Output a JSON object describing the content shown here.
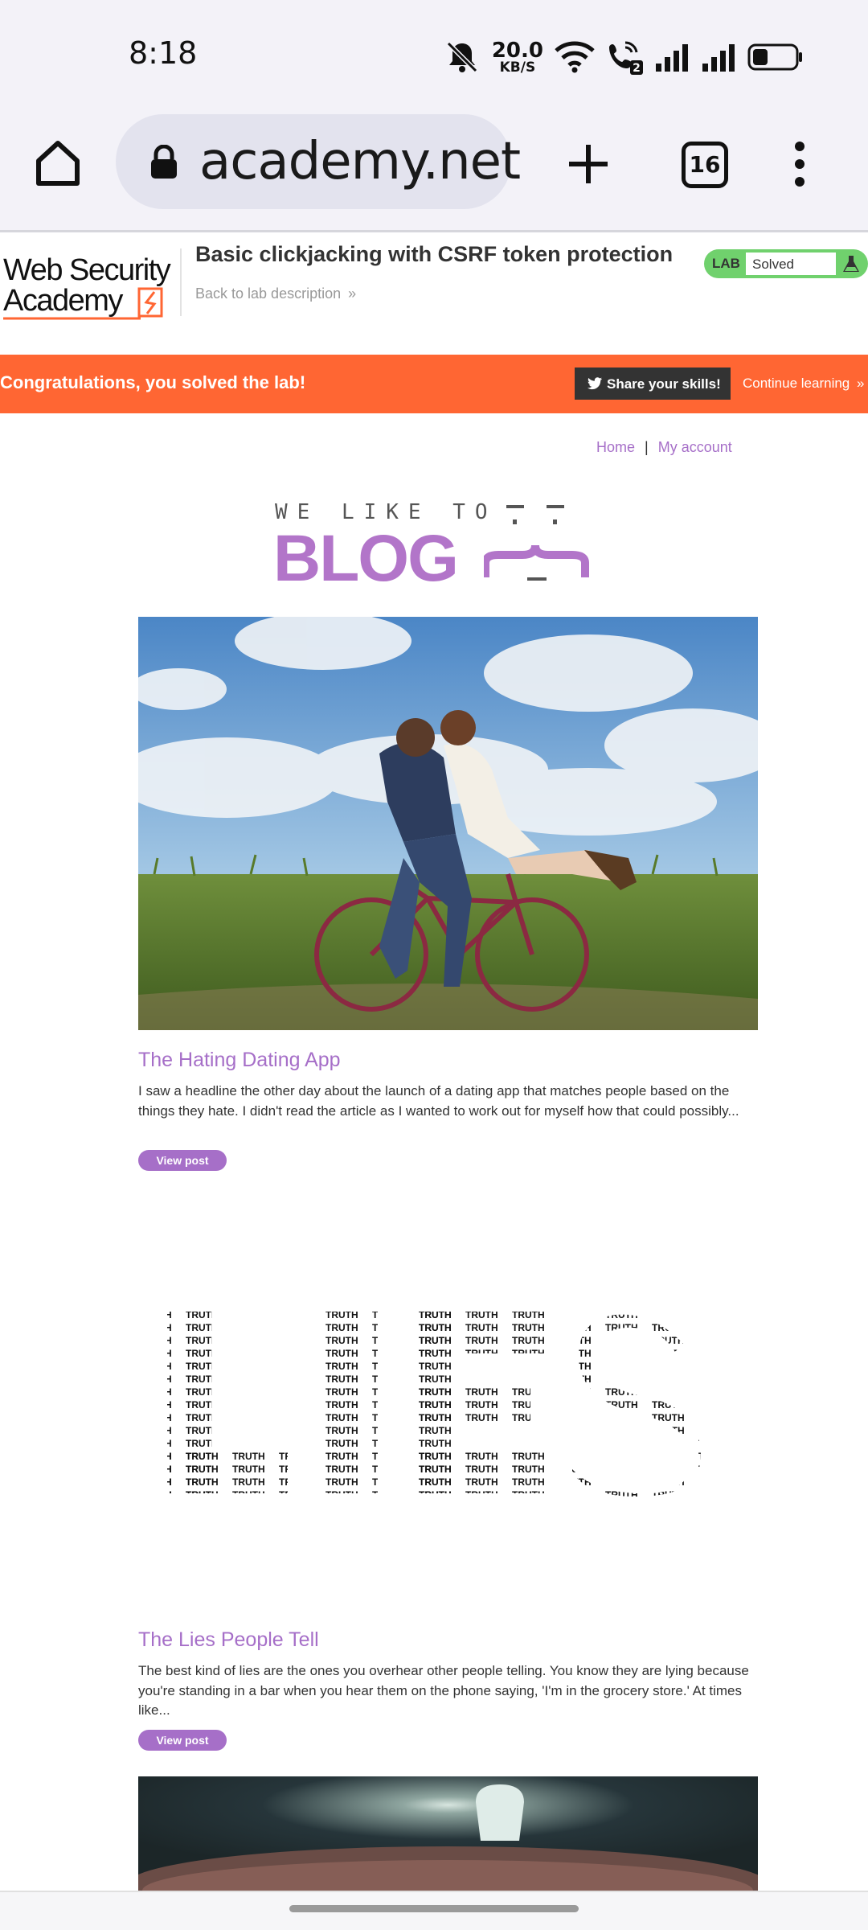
{
  "status_bar": {
    "time": "8:18",
    "net_speed_value": "20.0",
    "net_speed_unit": "KB/S",
    "sim_badge": "2"
  },
  "browser": {
    "url": "academy.net",
    "tab_count": "16"
  },
  "lab_header": {
    "logo_line1": "Web Security",
    "logo_line2": "Academy",
    "title": "Basic clickjacking with CSRF token protection",
    "back_link": "Back to lab description",
    "back_chevrons": "»",
    "badge_lab": "LAB",
    "badge_status": "Solved",
    "status_color": "#70d16d"
  },
  "banner": {
    "message": "Congratulations, you solved the lab!",
    "share_label": "Share your skills!",
    "continue_label": "Continue learning",
    "continue_chevrons": "»",
    "color": "#ff6633"
  },
  "blog_nav": {
    "home": "Home",
    "separator": "|",
    "account": "My account"
  },
  "blog_logo": {
    "tagline": "WE LIKE TO",
    "word": "BLOG",
    "accent": "#b275c9"
  },
  "posts": [
    {
      "title": "The Hating Dating App",
      "summary": "I saw a headline the other day about the launch of a dating app that matches people based on the things they hate. I didn't read the article as I wanted to work out for myself how that could possibly...",
      "button": "View post"
    },
    {
      "title": "The Lies People Tell",
      "summary": "The best kind of lies are the ones you overhear other people telling. You know they are lying because you're standing in a bar when you hear them on the phone saying, 'I'm in the grocery store.' At times like...",
      "button": "View post"
    }
  ]
}
